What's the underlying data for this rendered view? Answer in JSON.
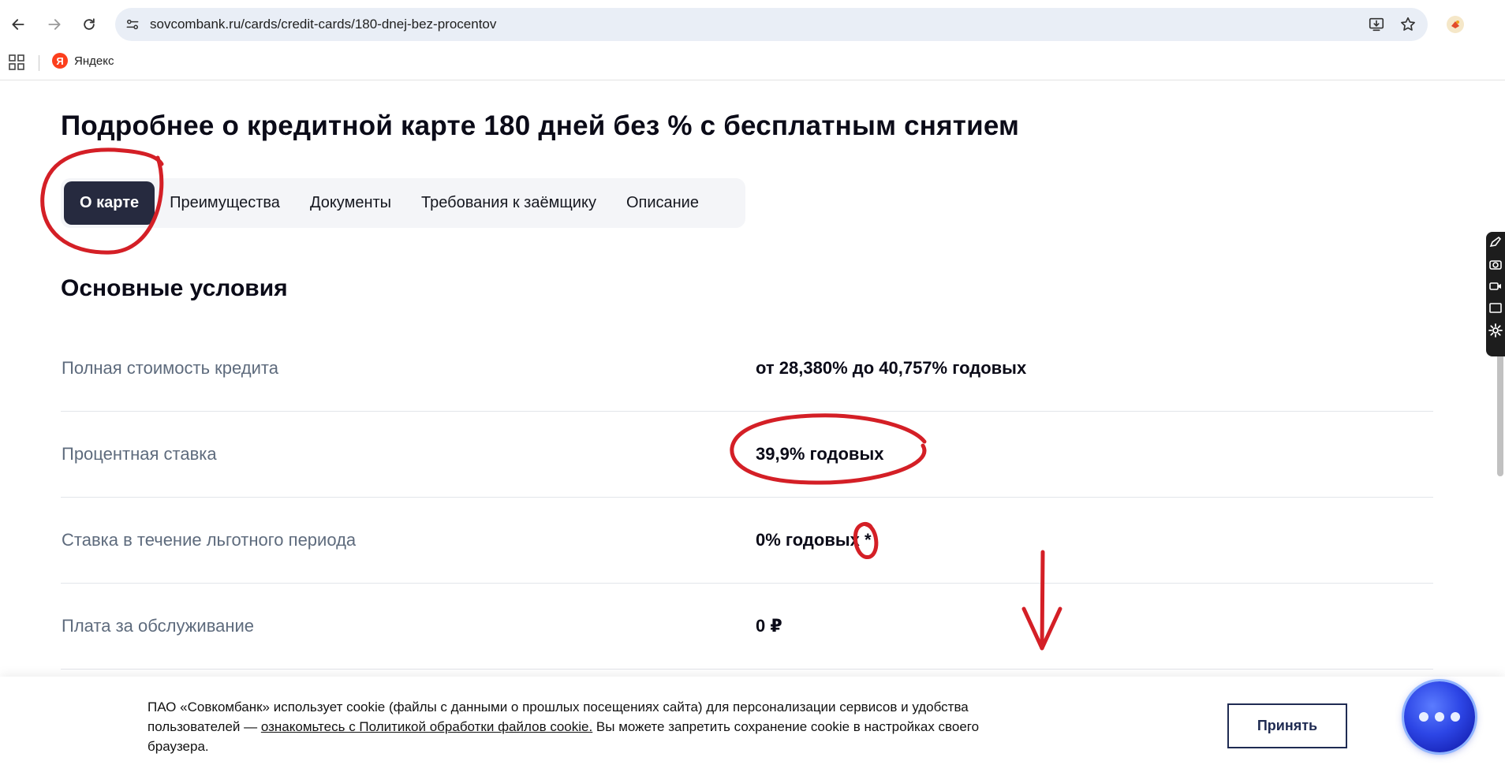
{
  "browser": {
    "url": "sovcombank.ru/cards/credit-cards/180-dnej-bez-procentov",
    "bookmark_label": "Яндекс",
    "bookmark_logo_letter": "Я"
  },
  "page": {
    "title": "Подробнее о кредитной карте 180 дней без % с бесплатным снятием",
    "tabs": [
      {
        "label": "О карте",
        "active": true
      },
      {
        "label": "Преимущества",
        "active": false
      },
      {
        "label": "Документы",
        "active": false
      },
      {
        "label": "Требования к заёмщику",
        "active": false
      },
      {
        "label": "Описание",
        "active": false
      }
    ],
    "section_title": "Основные условия",
    "conditions": [
      {
        "label": "Полная стоимость кредита",
        "value": "от 28,380% до 40,757% годовых"
      },
      {
        "label": "Процентная ставка",
        "value": "39,9% годовых"
      },
      {
        "label": "Ставка в течение льготного периода",
        "value": "0% годовых *"
      },
      {
        "label": "Плата за обслуживание",
        "value": "0 ₽"
      }
    ]
  },
  "cookie": {
    "text_before": "ПАО «Совкомбанк» использует cookie (файлы с данными о прошлых посещениях сайта) для персонализации сервисов и удобства пользователей — ",
    "link_text": "ознакомьтесь с Политикой обработки файлов cookie.",
    "text_after": " Вы можете запретить сохранение cookie в настройках своего браузера.",
    "accept_label": "Принять"
  },
  "colors": {
    "annotation": "#d41f26",
    "active_tab": "#262a3f",
    "accept_border": "#1f2b52"
  }
}
